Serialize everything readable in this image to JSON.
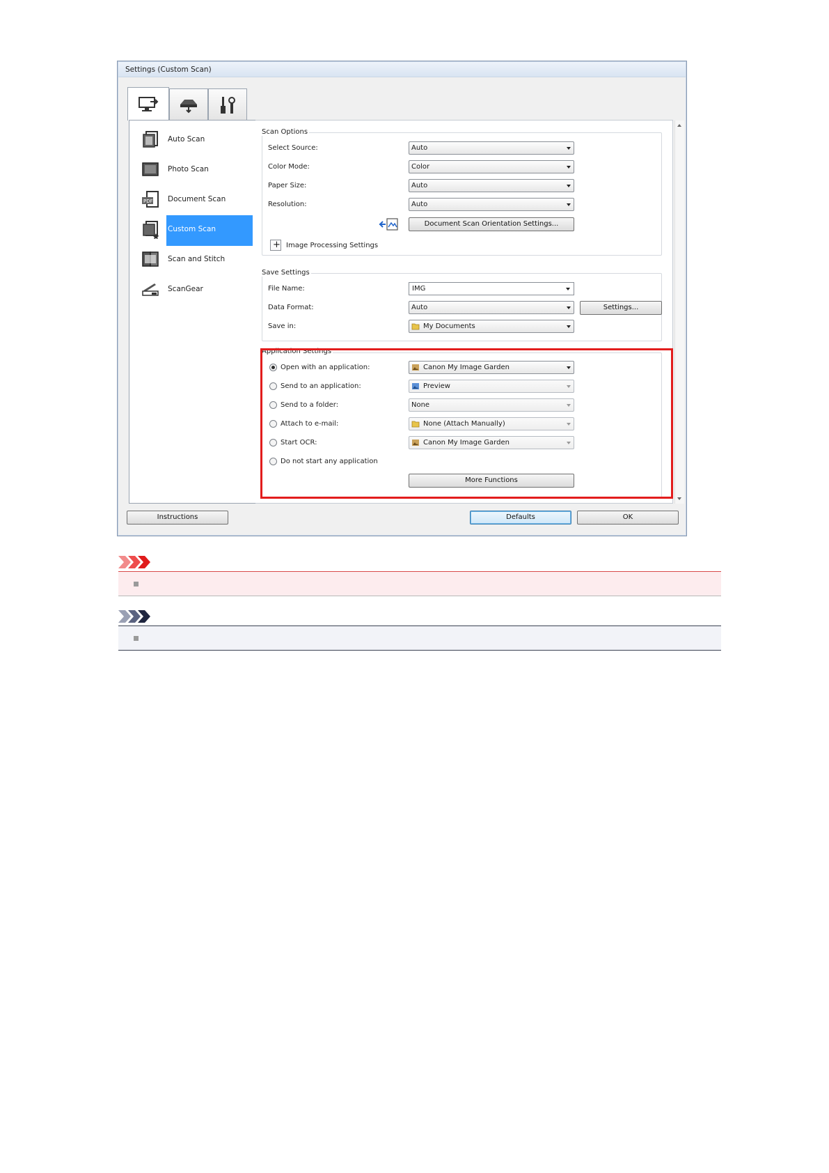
{
  "window": {
    "title": "Settings (Custom Scan)"
  },
  "tabs": [
    {
      "icon": "scan-from-computer-icon",
      "active": true
    },
    {
      "icon": "scan-from-operation-panel-icon",
      "active": false
    },
    {
      "icon": "general-settings-icon",
      "active": false
    }
  ],
  "sidebar": {
    "items": [
      {
        "label": "Auto Scan",
        "icon": "auto-scan-icon"
      },
      {
        "label": "Photo Scan",
        "icon": "photo-scan-icon"
      },
      {
        "label": "Document Scan",
        "icon": "document-scan-icon"
      },
      {
        "label": "Custom Scan",
        "icon": "custom-scan-icon",
        "selected": true
      },
      {
        "label": "Scan and Stitch",
        "icon": "scan-and-stitch-icon"
      },
      {
        "label": "ScanGear",
        "icon": "scangear-icon"
      }
    ]
  },
  "scan_options": {
    "title": "Scan Options",
    "select_source_label": "Select Source:",
    "select_source_value": "Auto",
    "color_mode_label": "Color Mode:",
    "color_mode_value": "Color",
    "paper_size_label": "Paper Size:",
    "paper_size_value": "Auto",
    "resolution_label": "Resolution:",
    "resolution_value": "Auto",
    "orientation_button": "Document Scan Orientation Settings...",
    "image_processing_label": "Image Processing Settings"
  },
  "save_settings": {
    "title": "Save Settings",
    "file_name_label": "File Name:",
    "file_name_value": "IMG",
    "data_format_label": "Data Format:",
    "data_format_value": "Auto",
    "settings_button": "Settings...",
    "save_in_label": "Save in:",
    "save_in_value": "My Documents"
  },
  "application_settings": {
    "title": "Application Settings",
    "open_app_label": "Open with an application:",
    "open_app_value": "Canon My Image Garden",
    "send_app_label": "Send to an application:",
    "send_app_value": "Preview",
    "send_folder_label": "Send to a folder:",
    "send_folder_value": "None",
    "attach_email_label": "Attach to e-mail:",
    "attach_email_value": "None (Attach Manually)",
    "start_ocr_label": "Start OCR:",
    "start_ocr_value": "Canon My Image Garden",
    "no_app_label": "Do not start any application",
    "more_functions_button": "More Functions",
    "selected_option": "open_app"
  },
  "footer": {
    "instructions_button": "Instructions",
    "defaults_button": "Defaults",
    "ok_button": "OK"
  },
  "colors": {
    "highlight_box": "#e21d1d",
    "selection": "#3399ff",
    "important_bar": "#fdecee",
    "note_bar": "#f2f3f8"
  }
}
